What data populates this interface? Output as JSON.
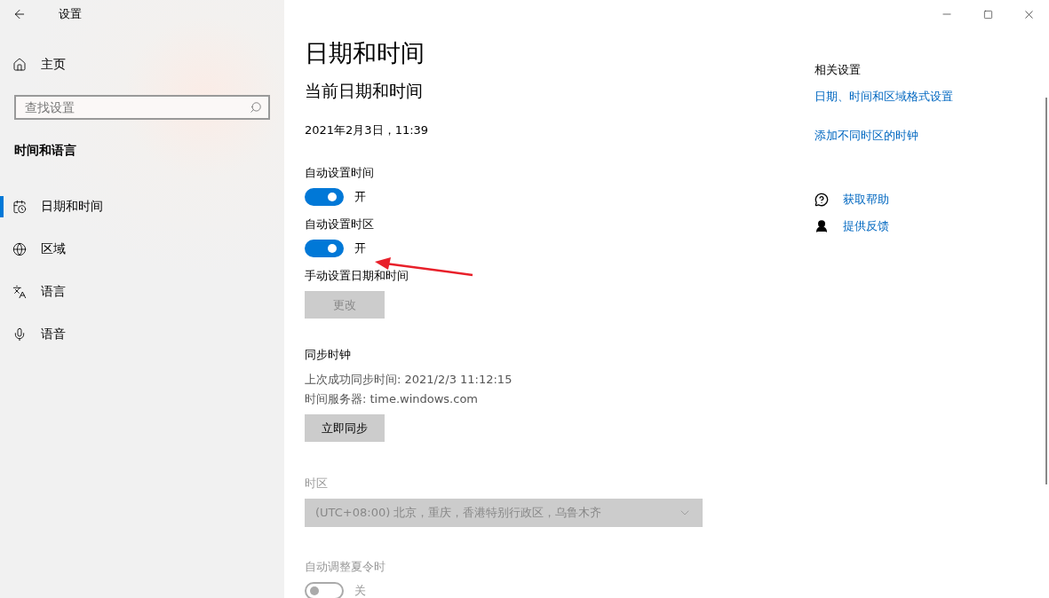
{
  "window": {
    "title": "设置"
  },
  "sidebar": {
    "home": "主页",
    "search": {
      "placeholder": "查找设置"
    },
    "section": "时间和语言",
    "items": [
      {
        "kind": "calendar",
        "label": "日期和时间",
        "selected": true
      },
      {
        "kind": "globe",
        "label": "区域",
        "selected": false
      },
      {
        "kind": "language",
        "label": "语言",
        "selected": false
      },
      {
        "kind": "microphone",
        "label": "语音",
        "selected": false
      }
    ]
  },
  "main": {
    "title": "日期和时间",
    "heading": "当前日期和时间",
    "current": "2021年2月3日，11:39",
    "settings": [
      {
        "kind": "toggle",
        "label": "自动设置时间",
        "on": true,
        "disabled": false,
        "state": "开"
      },
      {
        "kind": "toggle",
        "label": "自动设置时区",
        "on": true,
        "disabled": false,
        "state": "开"
      },
      {
        "kind": "button",
        "label": "手动设置日期和时间",
        "button": "更改",
        "disabled": true
      },
      {
        "kind": "sync",
        "label": "同步时钟",
        "lines": [
          "上次成功同步时间: 2021/2/3 11:12:15",
          "时间服务器: time.windows.com"
        ],
        "button": "立即同步",
        "disabled": false
      },
      {
        "kind": "dropdown",
        "label": "时区",
        "value": "(UTC+08:00) 北京，重庆，香港特别行政区，乌鲁木齐",
        "disabled": true
      },
      {
        "kind": "toggle",
        "label": "自动调整夏令时",
        "on": false,
        "disabled": true,
        "state": "关"
      }
    ]
  },
  "related": {
    "title": "相关设置",
    "links": [
      "日期、时间和区域格式设置",
      "添加不同时区的时钟"
    ],
    "help": [
      {
        "kind": "help",
        "label": "获取帮助"
      },
      {
        "kind": "feedback",
        "label": "提供反馈"
      }
    ]
  }
}
